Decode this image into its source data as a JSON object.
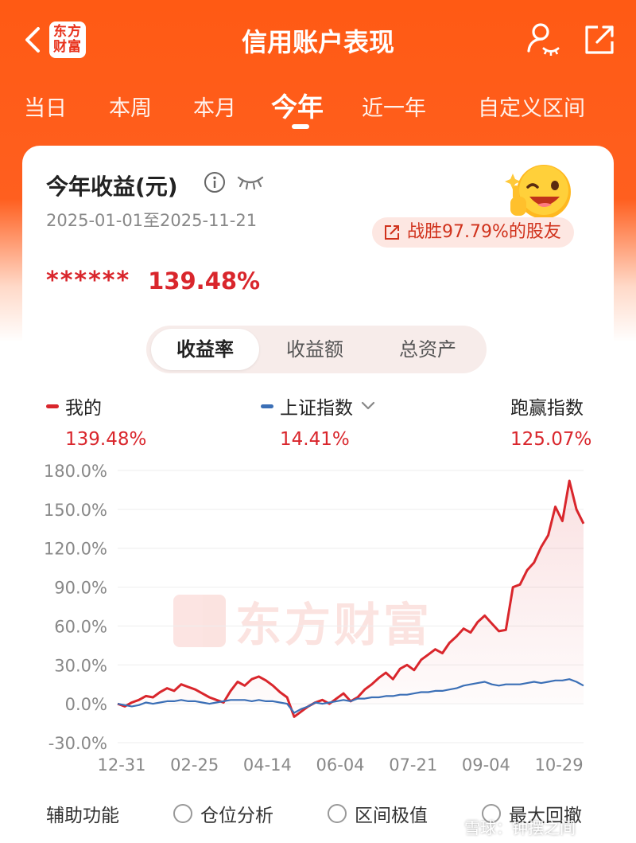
{
  "header": {
    "title": "信用账户表现",
    "logo_text": "东方\n财富"
  },
  "tabs": [
    {
      "label": "当日",
      "active": false
    },
    {
      "label": "本周",
      "active": false
    },
    {
      "label": "本月",
      "active": false
    },
    {
      "label": "今年",
      "active": true
    },
    {
      "label": "近一年",
      "active": false
    },
    {
      "label": "自定义区间",
      "active": false
    }
  ],
  "card": {
    "title": "今年收益(元)",
    "date_range": "2025-01-01至2025-11-21",
    "beat_text": "战胜97.79%的股友",
    "masked_amount": "******",
    "return_pct": "139.48%",
    "segments": [
      {
        "label": "收益率",
        "active": true
      },
      {
        "label": "收益额",
        "active": false
      },
      {
        "label": "总资产",
        "active": false
      }
    ],
    "legend": [
      {
        "name": "我的",
        "value": "139.48%",
        "color": "#d9262c"
      },
      {
        "name": "上证指数",
        "value": "14.41%",
        "color": "#3b6fb6"
      },
      {
        "name": "跑赢指数",
        "value": "125.07%"
      }
    ],
    "watermark": "东方财富",
    "aux": {
      "label": "辅助功能",
      "options": [
        "仓位分析",
        "区间极值",
        "最大回撤"
      ]
    }
  },
  "footer_watermark": "雪球：钟摆之间",
  "colors": {
    "brand_orange": "#ff5a14",
    "accent_red": "#d9262c",
    "index_blue": "#3b6fb6"
  },
  "chart_data": {
    "type": "line",
    "x_tick_labels": [
      "12-31",
      "02-25",
      "04-14",
      "06-04",
      "07-21",
      "09-04",
      "10-29"
    ],
    "y_tick_labels": [
      "180.0%",
      "150.0%",
      "120.0%",
      "90.0%",
      "60.0%",
      "30.0%",
      "0.0%",
      "-30.0%"
    ],
    "ylim": [
      -30,
      180
    ],
    "grid": true,
    "series": [
      {
        "name": "我的",
        "color": "#d9262c",
        "values": [
          0,
          -2,
          1,
          3,
          6,
          5,
          9,
          12,
          10,
          15,
          13,
          11,
          8,
          5,
          3,
          1,
          10,
          17,
          14,
          19,
          21,
          18,
          14,
          9,
          5,
          -10,
          -6,
          -2,
          1,
          3,
          0,
          4,
          8,
          2,
          5,
          11,
          15,
          20,
          24,
          19,
          27,
          30,
          26,
          34,
          38,
          42,
          39,
          47,
          52,
          58,
          55,
          63,
          68,
          62,
          56,
          57,
          90,
          92,
          103,
          109,
          121,
          130,
          152,
          141,
          172,
          150,
          139
        ]
      },
      {
        "name": "上证指数",
        "color": "#3b6fb6",
        "values": [
          0,
          -1,
          -2,
          -1,
          1,
          0,
          1,
          2,
          2,
          3,
          2,
          2,
          1,
          0,
          1,
          2,
          3,
          3,
          3,
          2,
          3,
          2,
          2,
          1,
          0,
          -7,
          -4,
          -2,
          1,
          0,
          1,
          2,
          3,
          2,
          4,
          4,
          5,
          5,
          6,
          6,
          7,
          7,
          8,
          9,
          9,
          10,
          10,
          11,
          12,
          14,
          15,
          16,
          17,
          15,
          14,
          15,
          15,
          15,
          16,
          17,
          16,
          17,
          18,
          18,
          19,
          17,
          14
        ]
      }
    ]
  }
}
